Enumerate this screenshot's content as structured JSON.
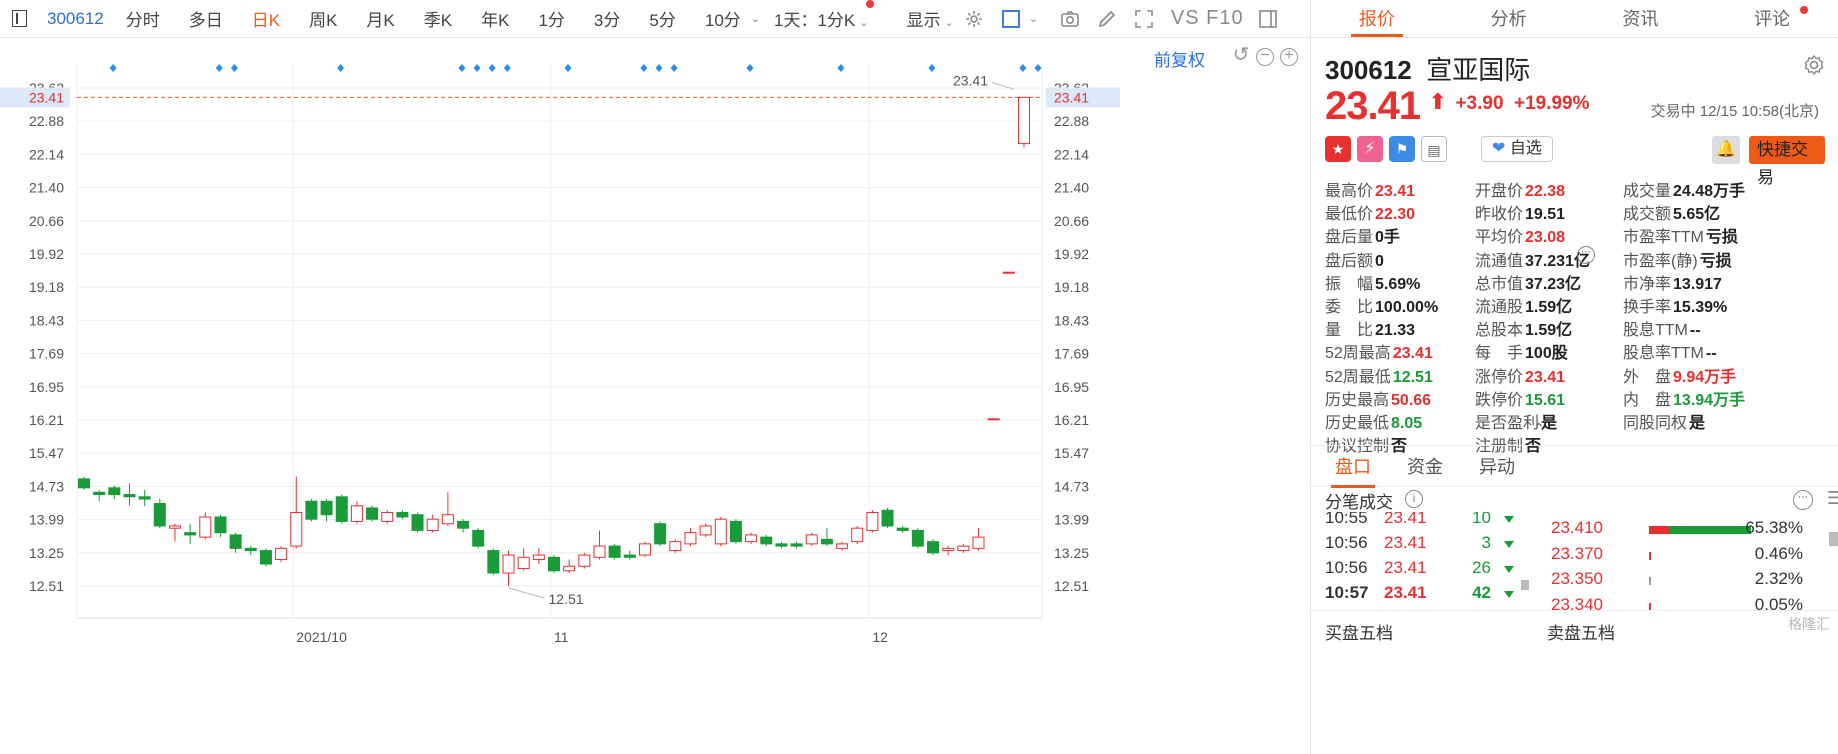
{
  "toolbar": {
    "code": "300612",
    "items": [
      {
        "label": "分时",
        "active": false
      },
      {
        "label": "多日",
        "active": false
      },
      {
        "label": "日K",
        "active": true
      },
      {
        "label": "周K",
        "active": false
      },
      {
        "label": "月K",
        "active": false
      },
      {
        "label": "季K",
        "active": false
      },
      {
        "label": "年K",
        "active": false
      },
      {
        "label": "1分",
        "active": false
      },
      {
        "label": "3分",
        "active": false
      },
      {
        "label": "5分",
        "active": false
      },
      {
        "label": "10分",
        "active": false
      }
    ],
    "period_select": "1天：1分K",
    "display_label": "显示",
    "tool_text": "VS F10"
  },
  "chart": {
    "adjust_label": "前复权",
    "price_line_label": "23.41",
    "high_annotation": "23.41",
    "low_annotation": "12.51",
    "date_labels": [
      "2021/10",
      "11",
      "12"
    ],
    "accent_color": "#f05a19",
    "up_color": "#e93030",
    "down_color": "#1a9b3a"
  },
  "chart_data": {
    "type": "candlestick",
    "y_tick_labels": [
      "23.62",
      "22.88",
      "22.14",
      "21.40",
      "20.66",
      "19.92",
      "19.18",
      "18.43",
      "17.69",
      "16.95",
      "16.21",
      "15.47",
      "14.73",
      "13.99",
      "13.25",
      "12.51"
    ],
    "ylim": [
      12.51,
      23.62
    ],
    "x_ticks": [
      "2021/10",
      "11",
      "12"
    ],
    "last_price": 23.41,
    "period_high": 23.41,
    "period_low": 12.51,
    "candles": [
      {
        "o": 14.9,
        "c": 14.7,
        "h": 14.95,
        "l": 14.65
      },
      {
        "o": 14.6,
        "c": 14.55,
        "h": 14.65,
        "l": 14.4
      },
      {
        "o": 14.7,
        "c": 14.55,
        "h": 14.75,
        "l": 14.45
      },
      {
        "o": 14.55,
        "c": 14.5,
        "h": 14.8,
        "l": 14.3
      },
      {
        "o": 14.5,
        "c": 14.45,
        "h": 14.65,
        "l": 14.3
      },
      {
        "o": 14.35,
        "c": 13.85,
        "h": 14.45,
        "l": 13.8
      },
      {
        "o": 13.8,
        "c": 13.85,
        "h": 13.9,
        "l": 13.5
      },
      {
        "o": 13.7,
        "c": 13.65,
        "h": 13.9,
        "l": 13.45
      },
      {
        "o": 13.6,
        "c": 14.05,
        "h": 14.15,
        "l": 13.55
      },
      {
        "o": 14.05,
        "c": 13.7,
        "h": 14.1,
        "l": 13.6
      },
      {
        "o": 13.65,
        "c": 13.35,
        "h": 13.7,
        "l": 13.25
      },
      {
        "o": 13.35,
        "c": 13.3,
        "h": 13.4,
        "l": 13.2
      },
      {
        "o": 13.3,
        "c": 13.0,
        "h": 13.35,
        "l": 12.95
      },
      {
        "o": 13.1,
        "c": 13.35,
        "h": 13.4,
        "l": 13.05
      },
      {
        "o": 13.4,
        "c": 14.15,
        "h": 14.95,
        "l": 13.35
      },
      {
        "o": 14.4,
        "c": 14.0,
        "h": 14.45,
        "l": 13.95
      },
      {
        "o": 14.4,
        "c": 14.1,
        "h": 14.45,
        "l": 13.95
      },
      {
        "o": 14.5,
        "c": 13.95,
        "h": 14.55,
        "l": 13.9
      },
      {
        "o": 13.95,
        "c": 14.3,
        "h": 14.4,
        "l": 13.9
      },
      {
        "o": 14.25,
        "c": 14.0,
        "h": 14.3,
        "l": 13.95
      },
      {
        "o": 13.95,
        "c": 14.15,
        "h": 14.2,
        "l": 13.9
      },
      {
        "o": 14.15,
        "c": 14.05,
        "h": 14.2,
        "l": 14.0
      },
      {
        "o": 14.1,
        "c": 13.75,
        "h": 14.15,
        "l": 13.7
      },
      {
        "o": 13.75,
        "c": 14.0,
        "h": 14.1,
        "l": 13.7
      },
      {
        "o": 13.9,
        "c": 14.1,
        "h": 14.6,
        "l": 13.85
      },
      {
        "o": 13.95,
        "c": 13.8,
        "h": 14.0,
        "l": 13.7
      },
      {
        "o": 13.75,
        "c": 13.4,
        "h": 13.8,
        "l": 13.35
      },
      {
        "o": 13.3,
        "c": 12.8,
        "h": 13.35,
        "l": 12.75
      },
      {
        "o": 12.8,
        "c": 13.2,
        "h": 13.3,
        "l": 12.51
      },
      {
        "o": 12.9,
        "c": 13.15,
        "h": 13.35,
        "l": 12.85
      },
      {
        "o": 13.1,
        "c": 13.2,
        "h": 13.35,
        "l": 13.0
      },
      {
        "o": 13.15,
        "c": 12.85,
        "h": 13.2,
        "l": 12.8
      },
      {
        "o": 12.85,
        "c": 12.95,
        "h": 13.1,
        "l": 12.8
      },
      {
        "o": 12.95,
        "c": 13.2,
        "h": 13.25,
        "l": 12.9
      },
      {
        "o": 13.15,
        "c": 13.4,
        "h": 13.75,
        "l": 13.1
      },
      {
        "o": 13.4,
        "c": 13.15,
        "h": 13.45,
        "l": 13.1
      },
      {
        "o": 13.2,
        "c": 13.15,
        "h": 13.3,
        "l": 13.1
      },
      {
        "o": 13.2,
        "c": 13.45,
        "h": 13.5,
        "l": 13.15
      },
      {
        "o": 13.9,
        "c": 13.45,
        "h": 13.95,
        "l": 13.4
      },
      {
        "o": 13.3,
        "c": 13.5,
        "h": 13.55,
        "l": 13.25
      },
      {
        "o": 13.45,
        "c": 13.7,
        "h": 13.8,
        "l": 13.4
      },
      {
        "o": 13.65,
        "c": 13.85,
        "h": 13.9,
        "l": 13.6
      },
      {
        "o": 13.45,
        "c": 14.0,
        "h": 14.05,
        "l": 13.4
      },
      {
        "o": 13.95,
        "c": 13.5,
        "h": 14.0,
        "l": 13.45
      },
      {
        "o": 13.5,
        "c": 13.65,
        "h": 13.7,
        "l": 13.45
      },
      {
        "o": 13.6,
        "c": 13.45,
        "h": 13.65,
        "l": 13.4
      },
      {
        "o": 13.45,
        "c": 13.4,
        "h": 13.5,
        "l": 13.35
      },
      {
        "o": 13.45,
        "c": 13.4,
        "h": 13.5,
        "l": 13.35
      },
      {
        "o": 13.45,
        "c": 13.65,
        "h": 13.7,
        "l": 13.4
      },
      {
        "o": 13.55,
        "c": 13.45,
        "h": 13.8,
        "l": 13.4
      },
      {
        "o": 13.35,
        "c": 13.45,
        "h": 13.5,
        "l": 13.3
      },
      {
        "o": 13.5,
        "c": 13.8,
        "h": 13.85,
        "l": 13.45
      },
      {
        "o": 13.75,
        "c": 14.15,
        "h": 14.2,
        "l": 13.7
      },
      {
        "o": 14.2,
        "c": 13.85,
        "h": 14.25,
        "l": 13.8
      },
      {
        "o": 13.8,
        "c": 13.75,
        "h": 13.85,
        "l": 13.7
      },
      {
        "o": 13.75,
        "c": 13.4,
        "h": 13.8,
        "l": 13.35
      },
      {
        "o": 13.5,
        "c": 13.25,
        "h": 13.55,
        "l": 13.2
      },
      {
        "o": 13.3,
        "c": 13.35,
        "h": 13.4,
        "l": 13.2
      },
      {
        "o": 13.3,
        "c": 13.4,
        "h": 13.45,
        "l": 13.25
      },
      {
        "o": 13.35,
        "c": 13.6,
        "h": 13.8,
        "l": 13.3
      },
      {
        "o": 16.24,
        "c": 16.24,
        "h": 16.24,
        "l": 16.24
      },
      {
        "o": 19.51,
        "c": 19.51,
        "h": 19.51,
        "l": 19.51
      },
      {
        "o": 22.38,
        "c": 23.41,
        "h": 23.41,
        "l": 22.3
      }
    ],
    "event_marker_count": 18
  },
  "stock": {
    "code": "300612",
    "name": "宣亚国际",
    "price": "23.41",
    "change": "+3.90",
    "change_pct": "+19.99%",
    "status": "交易中 12/15 10:58(北京)"
  },
  "tabs": [
    "报价",
    "分析",
    "资讯",
    "评论"
  ],
  "badges": {
    "watch_label": "自选",
    "quick_trade": "快捷交易"
  },
  "quote": [
    [
      {
        "label": "最高价",
        "value": "23.41",
        "color": "red"
      },
      {
        "label": "开盘价",
        "value": "22.38",
        "color": "red"
      },
      {
        "label": "成交量",
        "value": "24.48万手",
        "color": "black"
      }
    ],
    [
      {
        "label": "最低价",
        "value": "22.30",
        "color": "red"
      },
      {
        "label": "昨收价",
        "value": "19.51",
        "color": "black"
      },
      {
        "label": "成交额",
        "value": "5.65亿",
        "color": "black"
      }
    ],
    [
      {
        "label": "盘后量",
        "value": "0手",
        "color": "black"
      },
      {
        "label": "平均价",
        "value": "23.08",
        "color": "red"
      },
      {
        "label": "市盈率TTM",
        "value": "亏损",
        "color": "black"
      }
    ],
    [
      {
        "label": "盘后额",
        "value": "0",
        "color": "black"
      },
      {
        "label": "流通值",
        "value": "37.231亿",
        "color": "black"
      },
      {
        "label": "市盈率(静)",
        "value": "亏损",
        "color": "black"
      }
    ],
    [
      {
        "label": "振　幅",
        "value": "5.69%",
        "color": "black"
      },
      {
        "label": "总市值",
        "value": "37.23亿",
        "color": "black"
      },
      {
        "label": "市净率",
        "value": "13.917",
        "color": "black"
      }
    ],
    [
      {
        "label": "委　比",
        "value": "100.00%",
        "color": "black"
      },
      {
        "label": "流通股",
        "value": "1.59亿",
        "color": "black"
      },
      {
        "label": "换手率",
        "value": "15.39%",
        "color": "black"
      }
    ],
    [
      {
        "label": "量　比",
        "value": "21.33",
        "color": "black"
      },
      {
        "label": "总股本",
        "value": "1.59亿",
        "color": "black"
      },
      {
        "label": "股息TTM",
        "value": "--",
        "color": "black"
      }
    ],
    [
      {
        "label": "52周最高",
        "value": "23.41",
        "color": "red"
      },
      {
        "label": "每　手",
        "value": "100股",
        "color": "black"
      },
      {
        "label": "股息率TTM",
        "value": "--",
        "color": "black"
      }
    ],
    [
      {
        "label": "52周最低",
        "value": "12.51",
        "color": "green"
      },
      {
        "label": "涨停价",
        "value": "23.41",
        "color": "red"
      },
      {
        "label": "外　盘",
        "value": "9.94万手",
        "color": "red"
      }
    ],
    [
      {
        "label": "历史最高",
        "value": "50.66",
        "color": "red"
      },
      {
        "label": "跌停价",
        "value": "15.61",
        "color": "green"
      },
      {
        "label": "内　盘",
        "value": "13.94万手",
        "color": "green"
      }
    ],
    [
      {
        "label": "历史最低",
        "value": "8.05",
        "color": "green"
      },
      {
        "label": "是否盈利",
        "value": "是",
        "color": "black"
      },
      {
        "label": "同股同权",
        "value": "是",
        "color": "black"
      }
    ],
    [
      {
        "label": "协议控制",
        "value": "否",
        "color": "black"
      },
      {
        "label": "注册制",
        "value": "否",
        "color": "black"
      },
      null
    ]
  ],
  "sub_tabs": [
    "盘口",
    "资金",
    "异动"
  ],
  "trades_title": "分笔成交",
  "trades": [
    {
      "time": "10:55",
      "price": "23.41",
      "vol": "10"
    },
    {
      "time": "10:56",
      "price": "23.41",
      "vol": "3"
    },
    {
      "time": "10:56",
      "price": "23.41",
      "vol": "26"
    },
    {
      "time": "10:57",
      "price": "23.41",
      "vol": "42"
    }
  ],
  "levels": [
    {
      "price": "23.410",
      "pct": "65.38%",
      "pct_value": 65.38,
      "bar": "big"
    },
    {
      "price": "23.370",
      "pct": "0.46%",
      "pct_value": 0.46,
      "bar": "red"
    },
    {
      "price": "23.350",
      "pct": "2.32%",
      "pct_value": 2.32,
      "bar": "gray"
    },
    {
      "price": "23.340",
      "pct": "0.05%",
      "pct_value": 0.05,
      "bar": "red"
    }
  ],
  "bottom": {
    "buy_label": "买盘五档",
    "sell_label": "卖盘五档"
  },
  "watermark": "格隆汇"
}
